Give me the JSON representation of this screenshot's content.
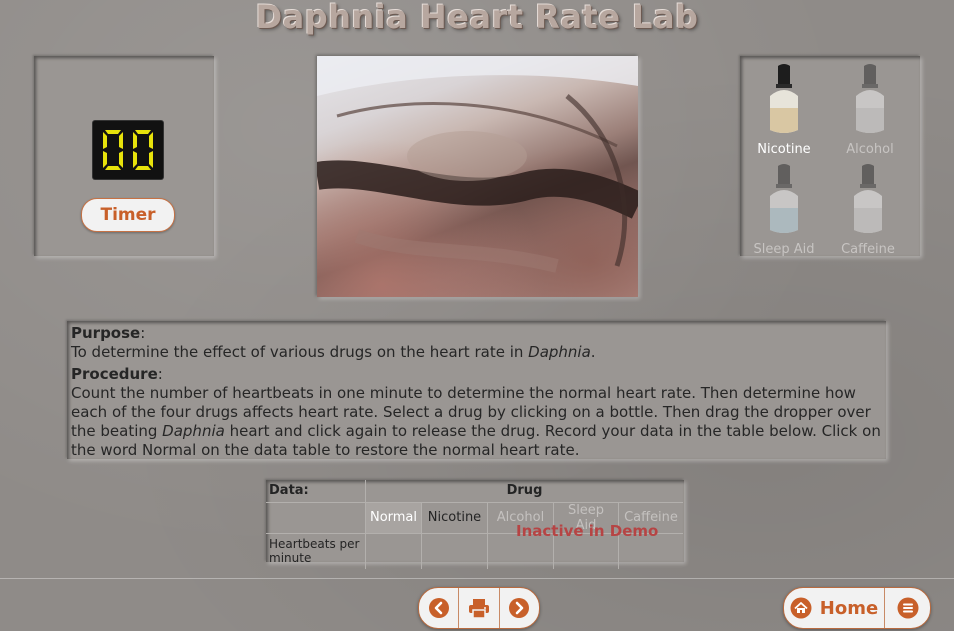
{
  "title": "Daphnia Heart Rate Lab",
  "timer": {
    "display": "00",
    "button_label": "Timer"
  },
  "drugs": [
    {
      "label": "Nicotine",
      "state": "active",
      "liquid": "#d9c7a3"
    },
    {
      "label": "Alcohol",
      "state": "inactive",
      "liquid": "#d8d8d8"
    },
    {
      "label": "Sleep Aid",
      "state": "inactive",
      "liquid": "#bcd6e2"
    },
    {
      "label": "Caffeine",
      "state": "inactive",
      "liquid": "#d8d8d8"
    }
  ],
  "purpose": {
    "heading": "Purpose",
    "text_pre": "To determine the effect of various drugs on the heart rate in ",
    "text_em": "Daphnia",
    "text_post": "."
  },
  "procedure": {
    "heading": "Procedure",
    "text_pre": "Count the number of heartbeats in one minute to determine the normal heart rate. Then determine how each of the four drugs affects heart rate. Select a drug by clicking on a bottle. Then drag the dropper over the beating ",
    "text_em": "Daphnia",
    "text_post": " heart and click again to release the drug. Record your data in the table below. Click on the word Normal on the data table to restore the normal heart rate."
  },
  "data_table": {
    "label": "Data:",
    "group_header": "Drug",
    "columns": [
      "Normal",
      "Nicotine",
      "Alcohol",
      "Sleep Aid",
      "Caffeine"
    ],
    "row_label": "Heartbeats per minute",
    "overlay": "Inactive in Demo"
  },
  "nav": {
    "home_label": "Home"
  },
  "colors": {
    "accent": "#c8602a",
    "inactive_text": "#b64444"
  }
}
